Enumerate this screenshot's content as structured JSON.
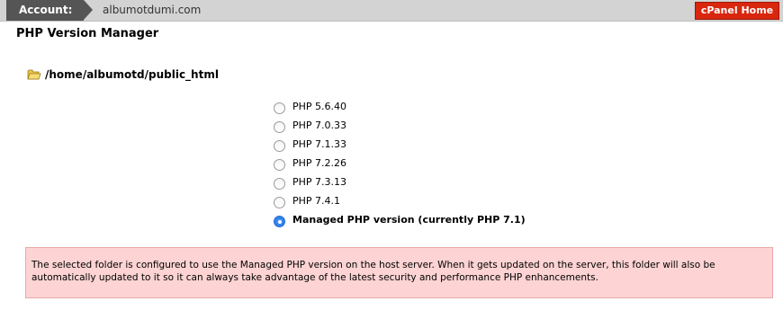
{
  "header": {
    "account_label": "Account:",
    "domain": "albumotdumi.com",
    "cpanel_home_label": "cPanel Home"
  },
  "page": {
    "title": "PHP Version Manager",
    "folder_path": "/home/albumotd/public_html"
  },
  "php_options": [
    {
      "label": "PHP 5.6.40",
      "selected": false
    },
    {
      "label": "PHP 7.0.33",
      "selected": false
    },
    {
      "label": "PHP 7.1.33",
      "selected": false
    },
    {
      "label": "PHP 7.2.26",
      "selected": false
    },
    {
      "label": "PHP 7.3.13",
      "selected": false
    },
    {
      "label": "PHP 7.4.1",
      "selected": false
    },
    {
      "label": "Managed PHP version (currently PHP 7.1)",
      "selected": true
    }
  ],
  "notice": {
    "text": "The selected folder is configured to use the Managed PHP version on the host server. When it gets updated on the server, this folder will also be automatically updated to it so it can always take advantage of the latest security and performance PHP enhancements."
  },
  "colors": {
    "topbar": "#d3d3d3",
    "account_tab": "#555555",
    "cpanel_button": "#d9260e",
    "notice_bg": "#fdd3d3",
    "radio_selected": "#1f6fe0"
  },
  "icons": {
    "folder": "folder-icon"
  }
}
